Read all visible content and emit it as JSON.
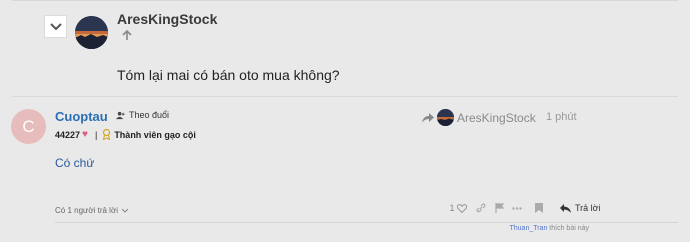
{
  "embedded_reply": {
    "author": "AresKingStock",
    "body": "Tóm lại mai có bán oto mua không?",
    "icons": [
      "chevron-down-icon",
      "arrow-up-icon"
    ]
  },
  "post": {
    "avatar_letter": "C",
    "avatar_color": "#e7bcbc",
    "username": "Cuoptau",
    "follow_label": "Theo đuổi",
    "score": "44227",
    "separator": "|",
    "rank_title": "Thành viên gạo cội",
    "reply_to_user": "AresKingStock",
    "time": "1 phút",
    "body": "Có chứ",
    "replies_toggle": "Có 1 người trả lời",
    "like_count": "1",
    "reply_label": "Trả lời",
    "liked_by_user": "Thuan_Tran",
    "liked_by_suffix": " thích bài này"
  },
  "colors": {
    "background": "#e9e9e9",
    "username": "#2a6fb5",
    "heart": "#e05a7a",
    "liker_link": "#5577cc"
  }
}
